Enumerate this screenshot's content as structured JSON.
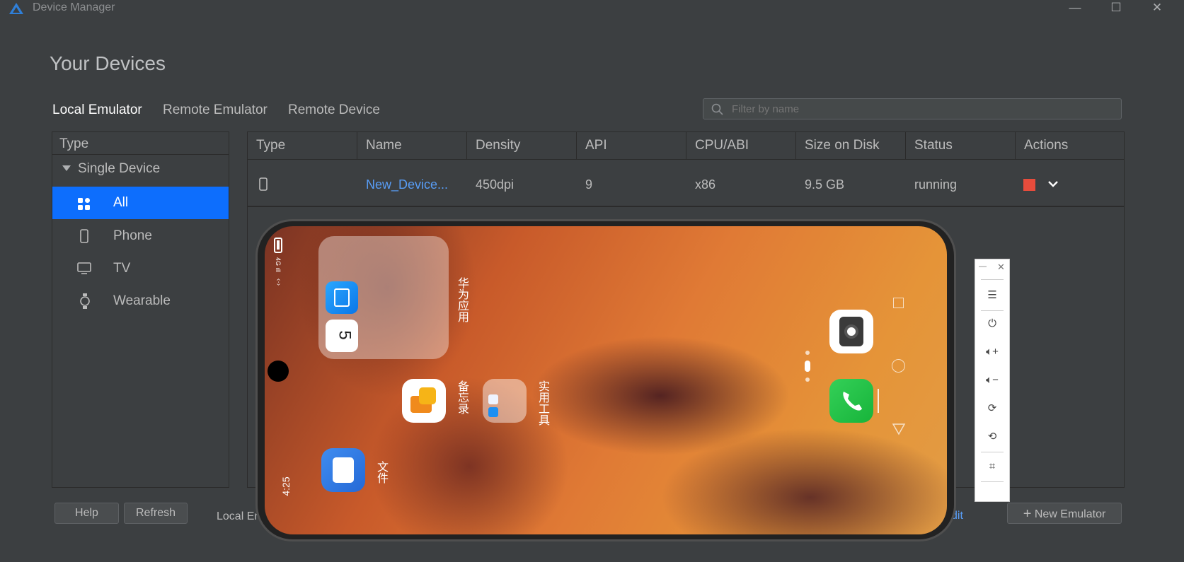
{
  "window": {
    "title": "Device Manager",
    "minimize": "—",
    "maximize": "☐",
    "close": "✕"
  },
  "page": {
    "heading": "Your Devices"
  },
  "tabs": [
    {
      "label": "Local Emulator"
    },
    {
      "label": "Remote Emulator"
    },
    {
      "label": "Remote Device"
    }
  ],
  "filter": {
    "placeholder": "Filter by name"
  },
  "left_panel": {
    "header": "Type",
    "group": "Single Device",
    "items": [
      {
        "label": "All",
        "icon": "grid-icon",
        "selected": true
      },
      {
        "label": "Phone",
        "icon": "phone-icon"
      },
      {
        "label": "TV",
        "icon": "tv-icon"
      },
      {
        "label": "Wearable",
        "icon": "watch-icon"
      }
    ]
  },
  "table": {
    "columns": [
      "Type",
      "Name",
      "Density",
      "API",
      "CPU/ABI",
      "Size on Disk",
      "Status",
      "Actions"
    ],
    "rows": [
      {
        "type_icon": "phone-icon",
        "name": "New_Device...",
        "density": "450dpi",
        "api": "9",
        "cpu": "x86",
        "size": "9.5 GB",
        "status": "running"
      }
    ]
  },
  "footer": {
    "help": "Help",
    "refresh": "Refresh",
    "local_text": "Local En",
    "edit_link": "dit",
    "new_emulator": "New Emulator"
  },
  "emulator": {
    "time": "4:25",
    "folders": [
      {
        "label": "华为应用"
      },
      {
        "label": "实用工具"
      }
    ],
    "apps": [
      {
        "label": "备忘录"
      },
      {
        "label": "文件"
      }
    ],
    "calendar_day": "5"
  },
  "colors": {
    "accent": "#2f65ca",
    "selected_bg": "#0d6efd",
    "link": "#589df6",
    "stop": "#e74c3c",
    "phone_green": "#2ecc40"
  }
}
